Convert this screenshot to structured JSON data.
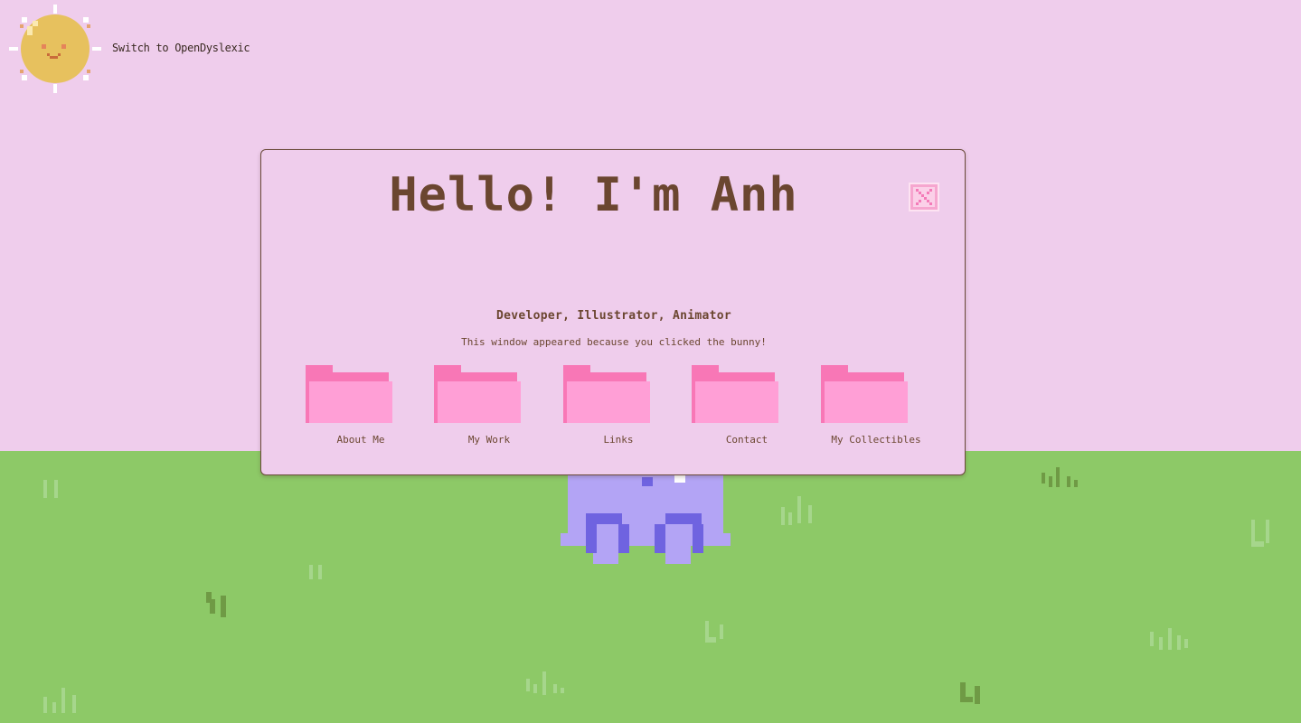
{
  "page": {
    "font_toggle_label": "Switch to OpenDyslexic"
  },
  "colors": {
    "sky": "#efcdec",
    "ground": "#8dc967",
    "grass_tuft": "#a6d68c",
    "grass_tuft_dark": "#6f9a45",
    "sun": "#e7c15e",
    "sun_rays": "#ffffff",
    "bunny": "#b3a4f5",
    "bunny_shadow": "#6f63e0",
    "window_bg": "#efcdec",
    "title_text": "#6b4630",
    "folder_front": "#ff9fd6",
    "folder_back": "#f877b6",
    "close_btn": "#f6a6cf"
  },
  "icons": {
    "sun": "sun-face-icon",
    "bunny": "bunny-icon",
    "close": "close-icon",
    "folder": "folder-icon"
  },
  "window": {
    "title": "Hello! I'm Anh",
    "subtitle": "Developer, Illustrator, Animator",
    "note": "This window appeared because you clicked the bunny!",
    "folders": [
      {
        "label": "About Me"
      },
      {
        "label": "My Work"
      },
      {
        "label": "Links"
      },
      {
        "label": "Contact"
      },
      {
        "label": "My Collectibles"
      }
    ]
  }
}
